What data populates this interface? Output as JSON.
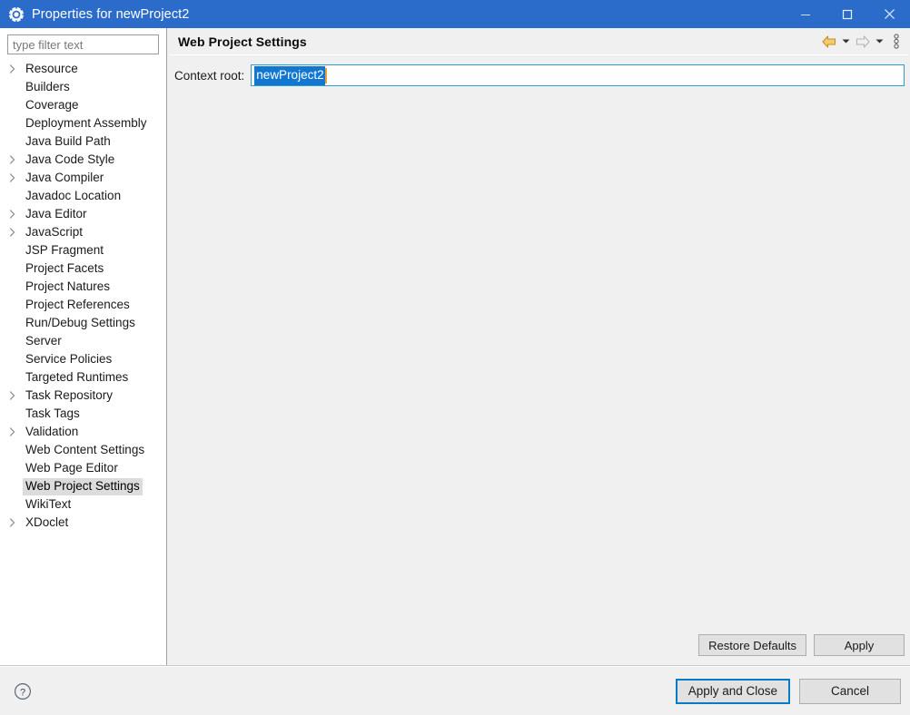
{
  "window": {
    "title": "Properties for newProject2",
    "icon": "gear-icon",
    "controls": {
      "minimize": "—",
      "maximize": "□",
      "close": "✕"
    },
    "titlebar_color": "#2b6ccb"
  },
  "sidebar": {
    "filter": {
      "placeholder": "type filter text",
      "value": ""
    },
    "items": [
      {
        "label": "Resource",
        "expandable": true,
        "selected": false
      },
      {
        "label": "Builders",
        "expandable": false,
        "selected": false
      },
      {
        "label": "Coverage",
        "expandable": false,
        "selected": false
      },
      {
        "label": "Deployment Assembly",
        "expandable": false,
        "selected": false
      },
      {
        "label": "Java Build Path",
        "expandable": false,
        "selected": false
      },
      {
        "label": "Java Code Style",
        "expandable": true,
        "selected": false
      },
      {
        "label": "Java Compiler",
        "expandable": true,
        "selected": false
      },
      {
        "label": "Javadoc Location",
        "expandable": false,
        "selected": false
      },
      {
        "label": "Java Editor",
        "expandable": true,
        "selected": false
      },
      {
        "label": "JavaScript",
        "expandable": true,
        "selected": false
      },
      {
        "label": "JSP Fragment",
        "expandable": false,
        "selected": false
      },
      {
        "label": "Project Facets",
        "expandable": false,
        "selected": false
      },
      {
        "label": "Project Natures",
        "expandable": false,
        "selected": false
      },
      {
        "label": "Project References",
        "expandable": false,
        "selected": false
      },
      {
        "label": "Run/Debug Settings",
        "expandable": false,
        "selected": false
      },
      {
        "label": "Server",
        "expandable": false,
        "selected": false
      },
      {
        "label": "Service Policies",
        "expandable": false,
        "selected": false
      },
      {
        "label": "Targeted Runtimes",
        "expandable": false,
        "selected": false
      },
      {
        "label": "Task Repository",
        "expandable": true,
        "selected": false
      },
      {
        "label": "Task Tags",
        "expandable": false,
        "selected": false
      },
      {
        "label": "Validation",
        "expandable": true,
        "selected": false
      },
      {
        "label": "Web Content Settings",
        "expandable": false,
        "selected": false
      },
      {
        "label": "Web Page Editor",
        "expandable": false,
        "selected": false
      },
      {
        "label": "Web Project Settings",
        "expandable": false,
        "selected": true
      },
      {
        "label": "WikiText",
        "expandable": false,
        "selected": false
      },
      {
        "label": "XDoclet",
        "expandable": true,
        "selected": false
      }
    ]
  },
  "page": {
    "title": "Web Project Settings",
    "nav": {
      "back_icon": "back-arrow-icon",
      "back_dropdown_icon": "chevron-down-icon",
      "forward_icon": "forward-arrow-icon",
      "forward_dropdown_icon": "chevron-down-icon",
      "menu_icon": "vertical-dots-menu-icon",
      "back_color": "#e8b33a",
      "forward_color": "#b8b8b8"
    },
    "field": {
      "label": "Context root:",
      "value": "newProject2",
      "selected": true,
      "selection_color": "#1177d1",
      "focus_border_color": "#2e9ad0"
    },
    "buttons": {
      "restore_defaults": "Restore Defaults",
      "apply": "Apply"
    }
  },
  "footer": {
    "help_icon": "help-question-icon",
    "apply_and_close": "Apply and Close",
    "cancel": "Cancel",
    "default_button_border": "#0a7ac4"
  }
}
